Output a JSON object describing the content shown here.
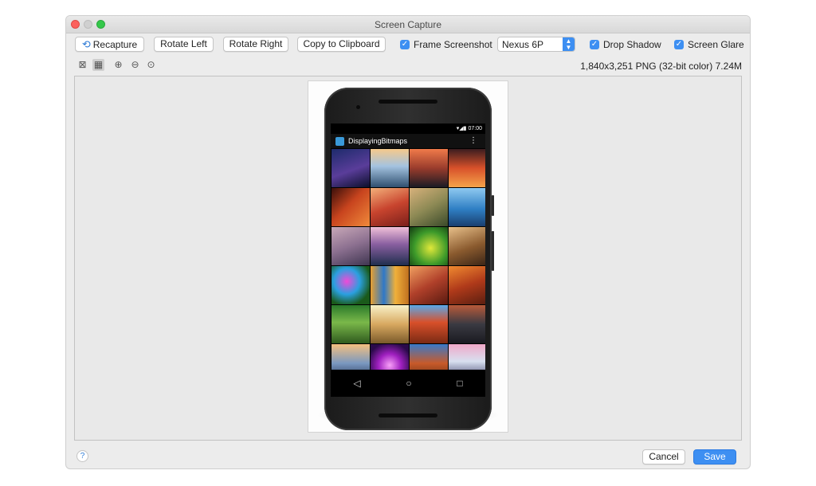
{
  "window": {
    "title": "Screen Capture"
  },
  "toolbar": {
    "recapture": "Recapture",
    "rotate_left": "Rotate Left",
    "rotate_right": "Rotate Right",
    "copy": "Copy to Clipboard",
    "frame_screenshot": {
      "label": "Frame Screenshot",
      "checked": true
    },
    "device": "Nexus 6P",
    "drop_shadow": {
      "label": "Drop Shadow",
      "checked": true
    },
    "screen_glare": {
      "label": "Screen Glare",
      "checked": true
    }
  },
  "viewbar": {
    "info": "1,840x3,251 PNG (32-bit color) 7.24M",
    "icons": [
      "fit-screen-icon",
      "actual-size-icon",
      "zoom-in-icon",
      "zoom-out-icon",
      "zoom-actual-icon"
    ]
  },
  "device_screen": {
    "status_time": "07:00",
    "app_title": "DisplayingBitmaps",
    "nav": {
      "back": "◁",
      "home": "○",
      "recents": "□"
    }
  },
  "footer": {
    "help": "?",
    "cancel": "Cancel",
    "save": "Save"
  },
  "colors": {
    "accent": "#3d8ff2",
    "window_bg": "#ececec",
    "viewport_bg": "#e9e9e9"
  }
}
